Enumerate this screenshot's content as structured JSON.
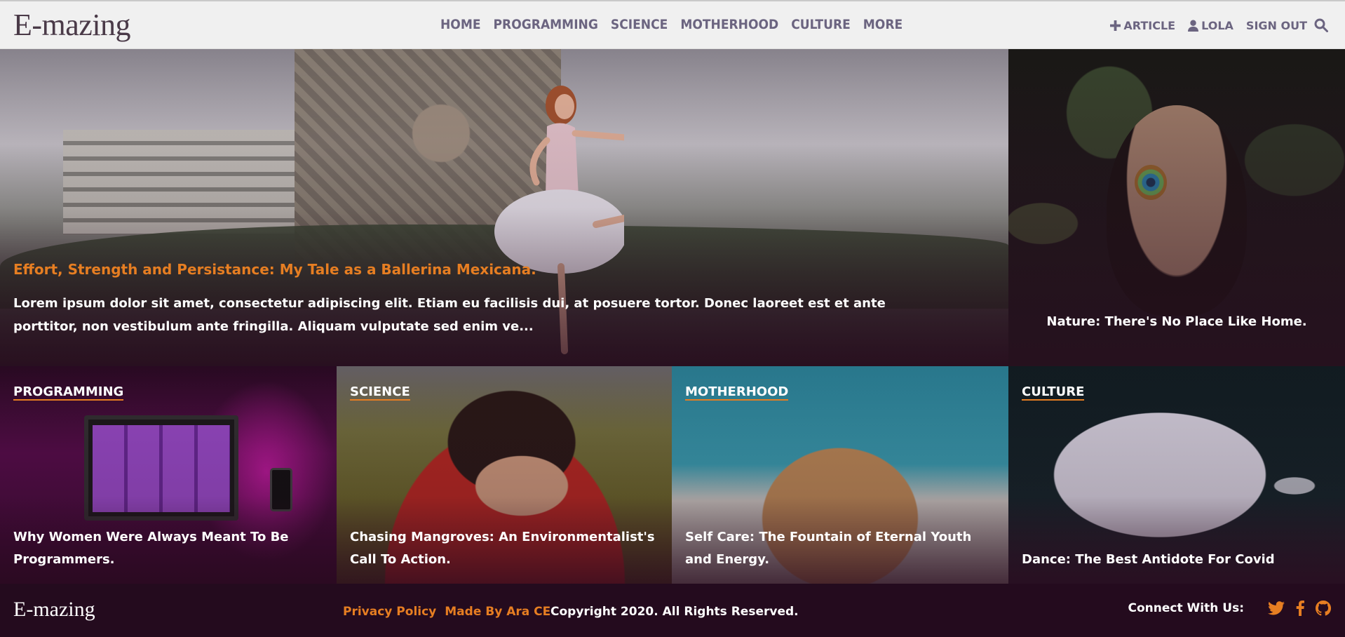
{
  "header": {
    "logo": "E-mazing",
    "nav": [
      "HOME",
      "PROGRAMMING",
      "SCIENCE",
      "MOTHERHOOD",
      "CULTURE",
      "MORE"
    ],
    "add_article": "ARTICLE",
    "user": "LOLA",
    "sign_out": "SIGN OUT",
    "icons": {
      "add": "plus-icon",
      "user": "user-icon",
      "search": "search-icon"
    }
  },
  "hero": {
    "title": "Effort, Strength and Persistance: My Tale as a Ballerina Mexicana.",
    "excerpt": "Lorem ipsum dolor sit amet, consectetur adipiscing elit. Etiam eu facilisis dui, at posuere tortor. Donec laoreet est et ante porttitor, non vestibulum ante fringilla. Aliquam vulputate sed enim ve..."
  },
  "side_feature": {
    "title": "Nature: There's No Place Like Home."
  },
  "categories": [
    {
      "category": "PROGRAMMING",
      "title": "Why Women Were Always Meant To Be Programmers."
    },
    {
      "category": "SCIENCE",
      "title": "Chasing Mangroves: An Environmentalist's Call To Action."
    },
    {
      "category": "MOTHERHOOD",
      "title": "Self Care: The Fountain of Eternal Youth and Energy."
    },
    {
      "category": "CULTURE",
      "title": "Dance: The Best Antidote For Covid"
    }
  ],
  "footer": {
    "logo": "E-mazing",
    "privacy": "Privacy Policy",
    "made_by": "Made By Ara CE",
    "copyright": "Copyright 2020. All Rights Reserved.",
    "connect": "Connect With Us:",
    "social_icons": [
      "twitter-icon",
      "facebook-icon",
      "github-icon"
    ]
  },
  "colors": {
    "accent": "#e67e22",
    "nav_text": "#6b6480",
    "footer_bg": "#240b1e",
    "header_bg": "#f0f0f0"
  }
}
